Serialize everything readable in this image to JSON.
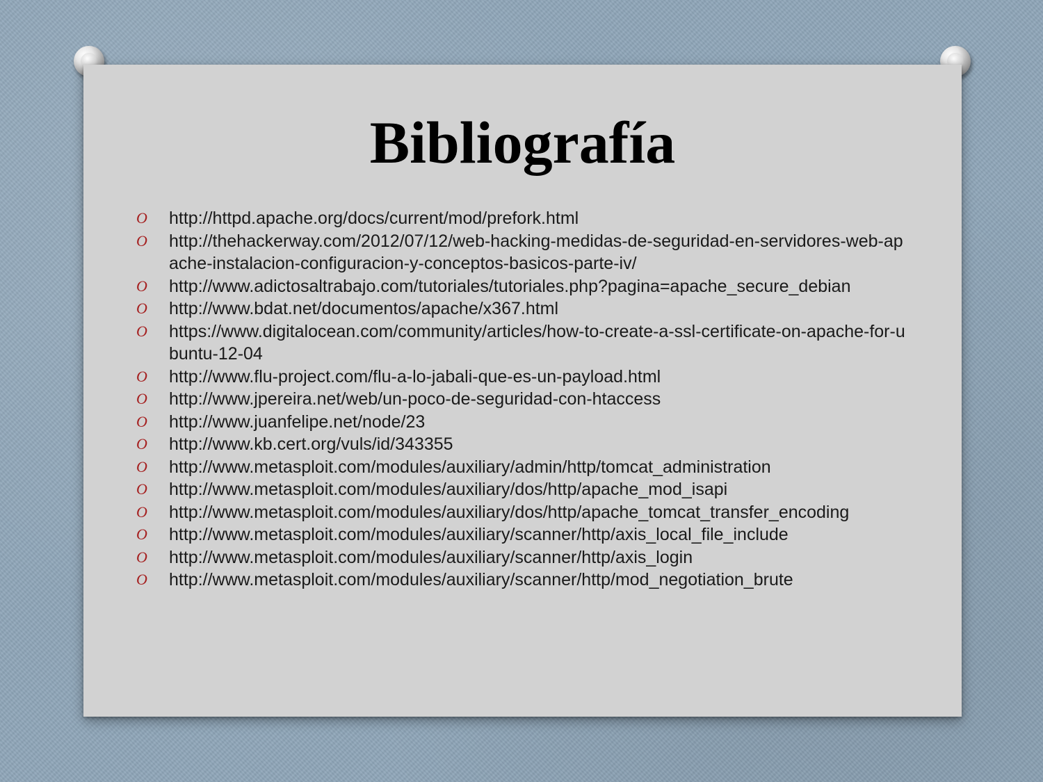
{
  "slide": {
    "title": "Bibliografía",
    "bullet_icon": "o-circle-bullet-icon",
    "bullet_glyph": "O",
    "colors": {
      "background": "#8ea5b8",
      "card": "#d2d2d2",
      "bullet": "#a51f1f",
      "text": "#1a1a1a"
    },
    "references": [
      "http://httpd.apache.org/docs/current/mod/prefork.html",
      "http://thehackerway.com/2012/07/12/web-hacking-medidas-de-seguridad-en-servidores-web-apache-instalacion-configuracion-y-conceptos-basicos-parte-iv/",
      "http://www.adictosaltrabajo.com/tutoriales/tutoriales.php?pagina=apache_secure_debian",
      "http://www.bdat.net/documentos/apache/x367.html",
      "https://www.digitalocean.com/community/articles/how-to-create-a-ssl-certificate-on-apache-for-ubuntu-12-04",
      "http://www.flu-project.com/flu-a-lo-jabali-que-es-un-payload.html",
      "http://www.jpereira.net/web/un-poco-de-seguridad-con-htaccess",
      "http://www.juanfelipe.net/node/23",
      "http://www.kb.cert.org/vuls/id/343355",
      "http://www.metasploit.com/modules/auxiliary/admin/http/tomcat_administration",
      "http://www.metasploit.com/modules/auxiliary/dos/http/apache_mod_isapi",
      "http://www.metasploit.com/modules/auxiliary/dos/http/apache_tomcat_transfer_encoding",
      "http://www.metasploit.com/modules/auxiliary/scanner/http/axis_local_file_include",
      "http://www.metasploit.com/modules/auxiliary/scanner/http/axis_login",
      "http://www.metasploit.com/modules/auxiliary/scanner/http/mod_negotiation_brute"
    ]
  }
}
